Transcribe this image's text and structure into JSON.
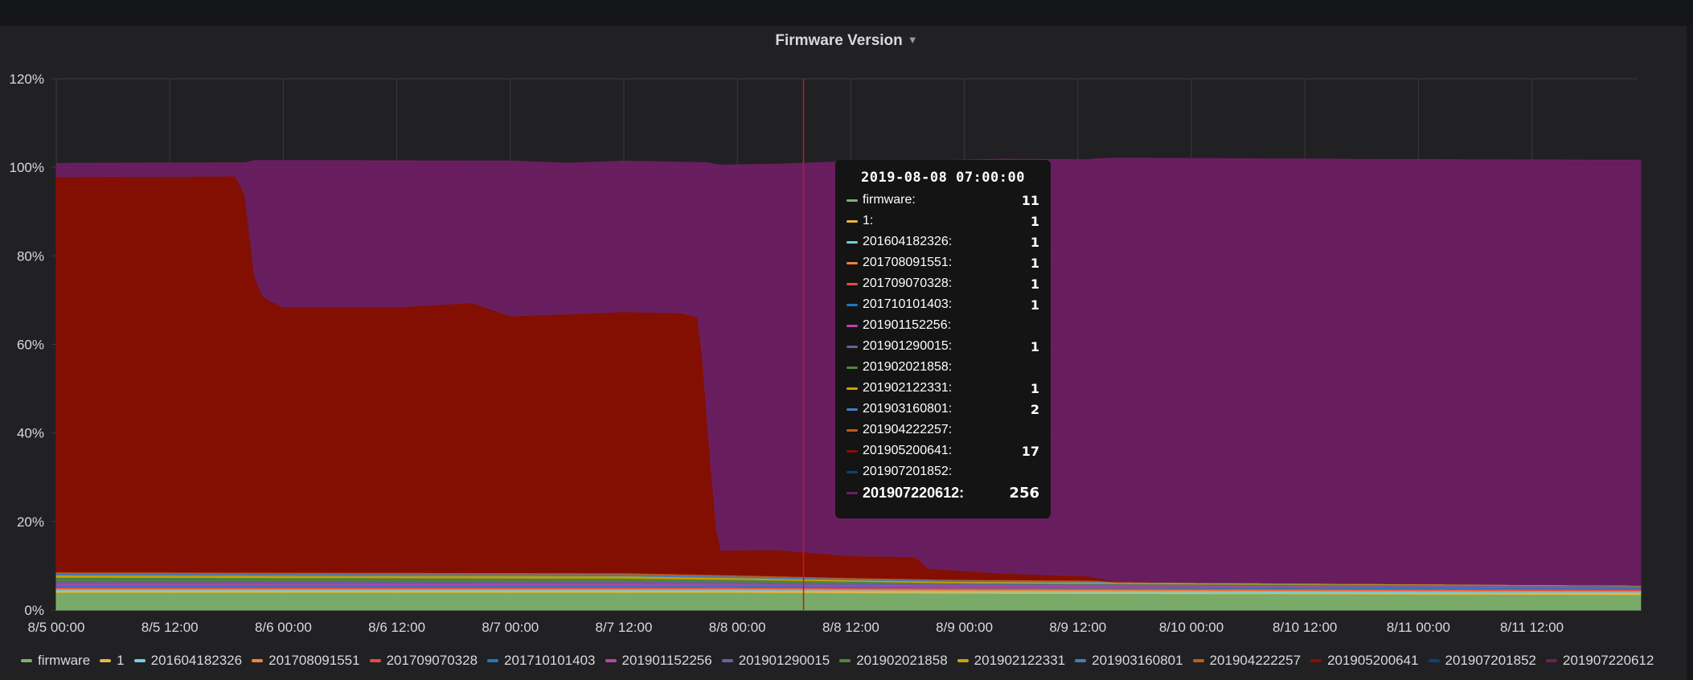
{
  "panel": {
    "title": "Firmware Version"
  },
  "chart_data": {
    "type": "area",
    "stacked": true,
    "percent": true,
    "y_ticks": [
      "0%",
      "20%",
      "40%",
      "60%",
      "80%",
      "100%",
      "120%"
    ],
    "ylim": [
      0,
      120
    ],
    "x_ticks": [
      "8/5 00:00",
      "8/5 12:00",
      "8/6 00:00",
      "8/6 12:00",
      "8/7 00:00",
      "8/7 12:00",
      "8/8 00:00",
      "8/8 12:00",
      "8/9 00:00",
      "8/9 12:00",
      "8/10 00:00",
      "8/10 12:00",
      "8/11 00:00",
      "8/11 12:00"
    ],
    "x_range_hours": [
      0,
      167.5
    ],
    "cursor_hour": 79,
    "grid": true,
    "legend_position": "bottom",
    "series": [
      {
        "name": "firmware",
        "color": "#7eb26d",
        "values": [
          [
            0,
            4
          ],
          [
            24,
            4
          ],
          [
            48,
            4
          ],
          [
            72,
            4
          ],
          [
            96,
            3.8
          ],
          [
            120,
            3.7
          ],
          [
            144,
            3.6
          ],
          [
            167.5,
            3.5
          ]
        ]
      },
      {
        "name": "1",
        "color": "#eab839",
        "values": [
          [
            0,
            0.3
          ],
          [
            167.5,
            0.3
          ]
        ]
      },
      {
        "name": "201604182326",
        "color": "#6ed0e0",
        "values": [
          [
            0,
            0.3
          ],
          [
            167.5,
            0.3
          ]
        ]
      },
      {
        "name": "201708091551",
        "color": "#ef843c",
        "values": [
          [
            0,
            0.3
          ],
          [
            167.5,
            0.3
          ]
        ]
      },
      {
        "name": "201709070328",
        "color": "#e24d42",
        "values": [
          [
            0,
            0.3
          ],
          [
            167.5,
            0.3
          ]
        ]
      },
      {
        "name": "201710101403",
        "color": "#1f78c1",
        "values": [
          [
            0,
            0.3
          ],
          [
            167.5,
            0.3
          ]
        ]
      },
      {
        "name": "201901152256",
        "color": "#ba43a9",
        "values": [
          [
            0,
            0.5
          ],
          [
            60,
            0.5
          ],
          [
            84,
            0.3
          ],
          [
            167.5,
            0.2
          ]
        ]
      },
      {
        "name": "201901290015",
        "color": "#705da0",
        "values": [
          [
            0,
            0.6
          ],
          [
            60,
            0.5
          ],
          [
            84,
            0.4
          ],
          [
            167.5,
            0.2
          ]
        ]
      },
      {
        "name": "201902021858",
        "color": "#508642",
        "values": [
          [
            0,
            0.8
          ],
          [
            60,
            0.7
          ],
          [
            84,
            0.4
          ],
          [
            94,
            0.2
          ],
          [
            167.5,
            0.1
          ]
        ]
      },
      {
        "name": "201902122331",
        "color": "#cca300",
        "values": [
          [
            0,
            0.5
          ],
          [
            60,
            0.5
          ],
          [
            84,
            0.3
          ],
          [
            167.5,
            0.1
          ]
        ]
      },
      {
        "name": "201903160801",
        "color": "#447ebc",
        "values": [
          [
            0,
            0.4
          ],
          [
            60,
            0.4
          ],
          [
            84,
            0.3
          ],
          [
            110,
            0.3
          ],
          [
            112,
            0
          ],
          [
            167.5,
            0
          ]
        ]
      },
      {
        "name": "201904222257",
        "color": "#c15c17",
        "values": [
          [
            0,
            0.3
          ],
          [
            60,
            0.3
          ],
          [
            84,
            0.2
          ],
          [
            167.5,
            0
          ]
        ]
      },
      {
        "name": "201905200641",
        "color": "#890f02",
        "values": [
          [
            0,
            89.3
          ],
          [
            19,
            89.5
          ],
          [
            20,
            85
          ],
          [
            21,
            66
          ],
          [
            22,
            62
          ],
          [
            24,
            60
          ],
          [
            28,
            60
          ],
          [
            36,
            60
          ],
          [
            44,
            61
          ],
          [
            48,
            58
          ],
          [
            54,
            58.5
          ],
          [
            60,
            59
          ],
          [
            66,
            59
          ],
          [
            68,
            58
          ],
          [
            69,
            30
          ],
          [
            70,
            5.5
          ],
          [
            76,
            6
          ],
          [
            84,
            5
          ],
          [
            91,
            5
          ],
          [
            92,
            2.5
          ],
          [
            100,
            1.5
          ],
          [
            109,
            1
          ],
          [
            112,
            0
          ],
          [
            167.5,
            0
          ]
        ]
      },
      {
        "name": "201907201852",
        "color": "#0a437c",
        "values": [
          [
            0,
            0
          ],
          [
            167.5,
            0
          ]
        ]
      },
      {
        "name": "201907220612",
        "color": "#6d1f62",
        "values": [
          [
            0,
            3
          ],
          [
            19,
            3
          ],
          [
            20,
            7.5
          ],
          [
            21,
            27
          ],
          [
            22,
            31
          ],
          [
            24,
            33
          ],
          [
            28,
            33
          ],
          [
            36,
            33
          ],
          [
            44,
            32
          ],
          [
            48,
            35
          ],
          [
            54,
            34
          ],
          [
            60,
            34
          ],
          [
            66,
            34
          ],
          [
            68,
            35
          ],
          [
            69,
            63
          ],
          [
            70,
            87
          ],
          [
            76,
            87
          ],
          [
            84,
            89
          ],
          [
            91,
            89.5
          ],
          [
            92,
            92
          ],
          [
            100,
            93.5
          ],
          [
            109,
            94
          ],
          [
            112,
            95.7
          ],
          [
            140,
            95.8
          ],
          [
            167.5,
            96
          ]
        ]
      }
    ]
  },
  "tooltip": {
    "time": "2019-08-08 07:00:00",
    "rows": [
      {
        "name": "firmware:",
        "value": "11",
        "color": "#7eb26d"
      },
      {
        "name": "1:",
        "value": "1",
        "color": "#eab839"
      },
      {
        "name": "201604182326:",
        "value": "1",
        "color": "#6ed0e0"
      },
      {
        "name": "201708091551:",
        "value": "1",
        "color": "#ef843c"
      },
      {
        "name": "201709070328:",
        "value": "1",
        "color": "#e24d42"
      },
      {
        "name": "201710101403:",
        "value": "1",
        "color": "#1f78c1"
      },
      {
        "name": "201901152256:",
        "value": "",
        "color": "#ba43a9"
      },
      {
        "name": "201901290015:",
        "value": "1",
        "color": "#705da0"
      },
      {
        "name": "201902021858:",
        "value": "",
        "color": "#508642"
      },
      {
        "name": "201902122331:",
        "value": "1",
        "color": "#cca300"
      },
      {
        "name": "201903160801:",
        "value": "2",
        "color": "#447ebc"
      },
      {
        "name": "201904222257:",
        "value": "",
        "color": "#c15c17"
      },
      {
        "name": "201905200641:",
        "value": "17",
        "color": "#890f02"
      },
      {
        "name": "201907201852:",
        "value": "",
        "color": "#0a437c"
      },
      {
        "name": "201907220612:",
        "value": "256",
        "color": "#6d1f62",
        "highlight": true
      }
    ]
  },
  "legend": [
    {
      "name": "firmware",
      "color": "#7eb26d"
    },
    {
      "name": "1",
      "color": "#eab839"
    },
    {
      "name": "201604182326",
      "color": "#6ed0e0"
    },
    {
      "name": "201708091551",
      "color": "#ef843c"
    },
    {
      "name": "201709070328",
      "color": "#e24d42"
    },
    {
      "name": "201710101403",
      "color": "#1f78c1"
    },
    {
      "name": "201901152256",
      "color": "#ba43a9"
    },
    {
      "name": "201901290015",
      "color": "#705da0"
    },
    {
      "name": "201902021858",
      "color": "#508642"
    },
    {
      "name": "201902122331",
      "color": "#cca300"
    },
    {
      "name": "201903160801",
      "color": "#447ebc"
    },
    {
      "name": "201904222257",
      "color": "#c15c17"
    },
    {
      "name": "201905200641",
      "color": "#890f02"
    },
    {
      "name": "201907201852",
      "color": "#0a437c"
    },
    {
      "name": "201907220612",
      "color": "#6d1f62"
    }
  ]
}
